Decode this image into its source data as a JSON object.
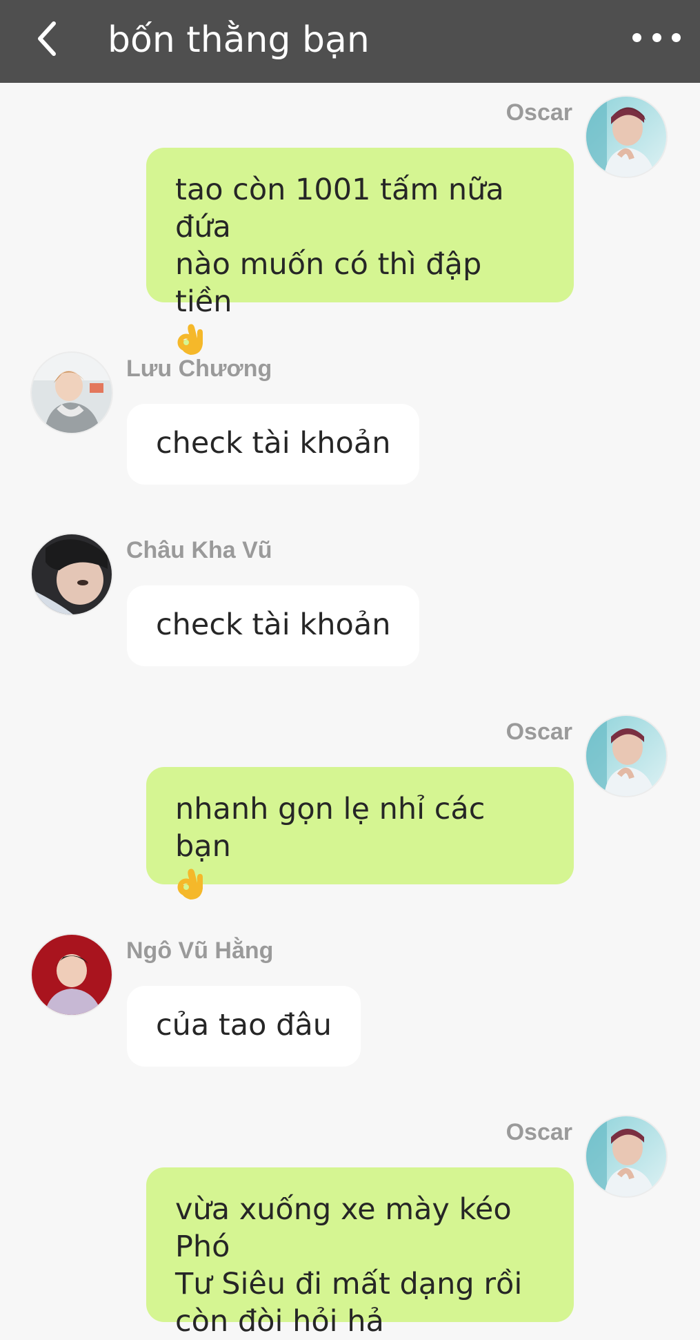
{
  "header": {
    "title": "bốn thằng bạn",
    "back_icon": "chevron-left-icon",
    "more_icon": "more-horizontal-icon",
    "background": "#4f4f4f"
  },
  "colors": {
    "outgoing_bubble": "#d5f592",
    "incoming_bubble": "#ffffff",
    "chat_background": "#f7f7f7",
    "sender_name": "#9a9a9a"
  },
  "messages": [
    {
      "direction": "out",
      "sender": "Oscar",
      "avatar": "avatar-oscar",
      "lines": [
        "tao còn 1001 tấm nữa đứa",
        "nào muốn có thì đập tiền"
      ],
      "emoji": "ok-hand-emoji"
    },
    {
      "direction": "in",
      "sender": "Lưu Chương",
      "avatar": "avatar-luu-chuong",
      "lines": [
        "check tài khoản"
      ]
    },
    {
      "direction": "in",
      "sender": "Châu Kha Vũ",
      "avatar": "avatar-chau-kha-vu",
      "lines": [
        "check tài khoản"
      ]
    },
    {
      "direction": "out",
      "sender": "Oscar",
      "avatar": "avatar-oscar",
      "lines": [
        "nhanh gọn lẹ nhỉ các bạn"
      ],
      "emoji": "ok-hand-emoji"
    },
    {
      "direction": "in",
      "sender": "Ngô Vũ Hằng",
      "avatar": "avatar-ngo-vu-hang",
      "lines": [
        "của tao đâu"
      ]
    },
    {
      "direction": "out",
      "sender": "Oscar",
      "avatar": "avatar-oscar",
      "lines": [
        "vừa xuống xe mày kéo Phó",
        "Tư Siêu đi mất dạng rồi",
        "còn đòi hỏi hả"
      ]
    }
  ]
}
